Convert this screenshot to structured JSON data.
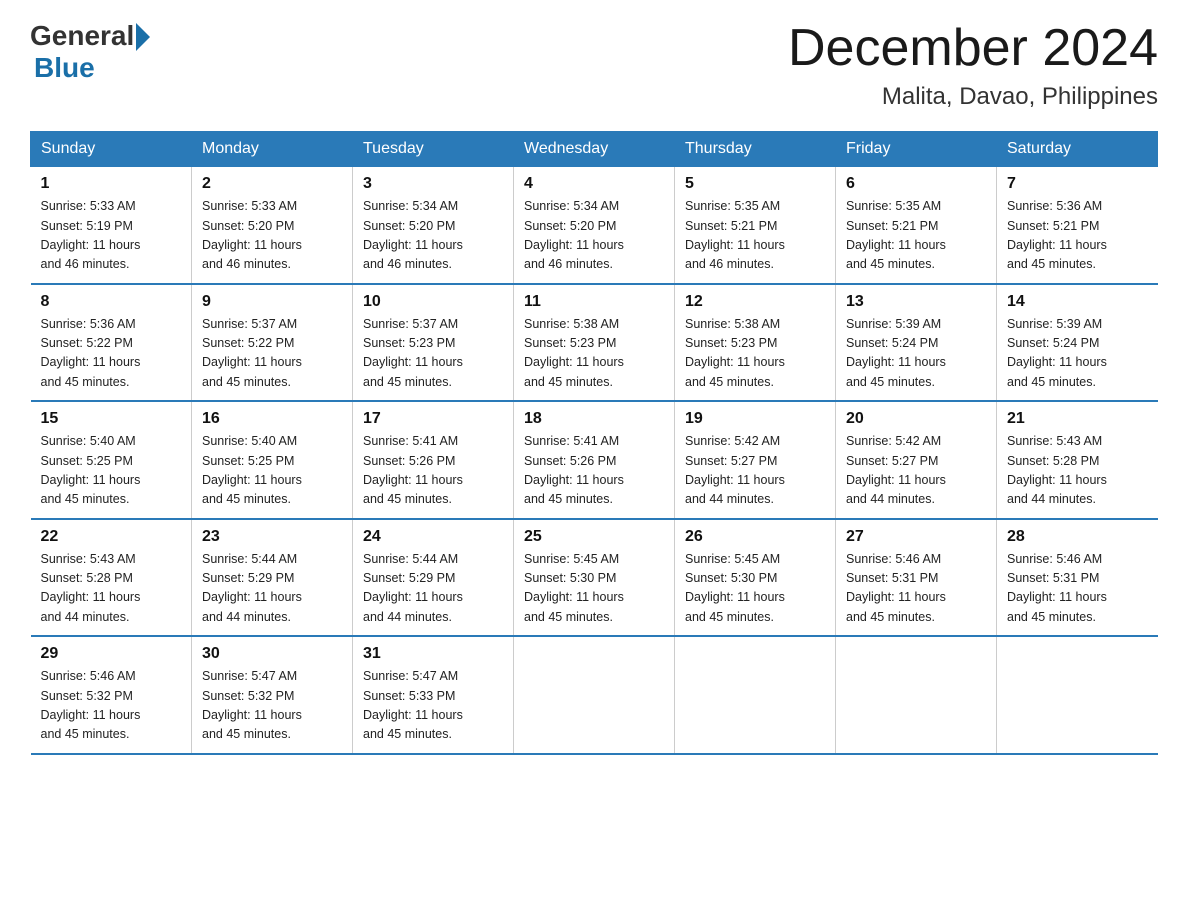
{
  "header": {
    "logo_general": "General",
    "logo_blue": "Blue",
    "month_title": "December 2024",
    "location": "Malita, Davao, Philippines"
  },
  "columns": [
    "Sunday",
    "Monday",
    "Tuesday",
    "Wednesday",
    "Thursday",
    "Friday",
    "Saturday"
  ],
  "weeks": [
    [
      {
        "day": "1",
        "sunrise": "5:33 AM",
        "sunset": "5:19 PM",
        "daylight": "11 hours and 46 minutes."
      },
      {
        "day": "2",
        "sunrise": "5:33 AM",
        "sunset": "5:20 PM",
        "daylight": "11 hours and 46 minutes."
      },
      {
        "day": "3",
        "sunrise": "5:34 AM",
        "sunset": "5:20 PM",
        "daylight": "11 hours and 46 minutes."
      },
      {
        "day": "4",
        "sunrise": "5:34 AM",
        "sunset": "5:20 PM",
        "daylight": "11 hours and 46 minutes."
      },
      {
        "day": "5",
        "sunrise": "5:35 AM",
        "sunset": "5:21 PM",
        "daylight": "11 hours and 46 minutes."
      },
      {
        "day": "6",
        "sunrise": "5:35 AM",
        "sunset": "5:21 PM",
        "daylight": "11 hours and 45 minutes."
      },
      {
        "day": "7",
        "sunrise": "5:36 AM",
        "sunset": "5:21 PM",
        "daylight": "11 hours and 45 minutes."
      }
    ],
    [
      {
        "day": "8",
        "sunrise": "5:36 AM",
        "sunset": "5:22 PM",
        "daylight": "11 hours and 45 minutes."
      },
      {
        "day": "9",
        "sunrise": "5:37 AM",
        "sunset": "5:22 PM",
        "daylight": "11 hours and 45 minutes."
      },
      {
        "day": "10",
        "sunrise": "5:37 AM",
        "sunset": "5:23 PM",
        "daylight": "11 hours and 45 minutes."
      },
      {
        "day": "11",
        "sunrise": "5:38 AM",
        "sunset": "5:23 PM",
        "daylight": "11 hours and 45 minutes."
      },
      {
        "day": "12",
        "sunrise": "5:38 AM",
        "sunset": "5:23 PM",
        "daylight": "11 hours and 45 minutes."
      },
      {
        "day": "13",
        "sunrise": "5:39 AM",
        "sunset": "5:24 PM",
        "daylight": "11 hours and 45 minutes."
      },
      {
        "day": "14",
        "sunrise": "5:39 AM",
        "sunset": "5:24 PM",
        "daylight": "11 hours and 45 minutes."
      }
    ],
    [
      {
        "day": "15",
        "sunrise": "5:40 AM",
        "sunset": "5:25 PM",
        "daylight": "11 hours and 45 minutes."
      },
      {
        "day": "16",
        "sunrise": "5:40 AM",
        "sunset": "5:25 PM",
        "daylight": "11 hours and 45 minutes."
      },
      {
        "day": "17",
        "sunrise": "5:41 AM",
        "sunset": "5:26 PM",
        "daylight": "11 hours and 45 minutes."
      },
      {
        "day": "18",
        "sunrise": "5:41 AM",
        "sunset": "5:26 PM",
        "daylight": "11 hours and 45 minutes."
      },
      {
        "day": "19",
        "sunrise": "5:42 AM",
        "sunset": "5:27 PM",
        "daylight": "11 hours and 44 minutes."
      },
      {
        "day": "20",
        "sunrise": "5:42 AM",
        "sunset": "5:27 PM",
        "daylight": "11 hours and 44 minutes."
      },
      {
        "day": "21",
        "sunrise": "5:43 AM",
        "sunset": "5:28 PM",
        "daylight": "11 hours and 44 minutes."
      }
    ],
    [
      {
        "day": "22",
        "sunrise": "5:43 AM",
        "sunset": "5:28 PM",
        "daylight": "11 hours and 44 minutes."
      },
      {
        "day": "23",
        "sunrise": "5:44 AM",
        "sunset": "5:29 PM",
        "daylight": "11 hours and 44 minutes."
      },
      {
        "day": "24",
        "sunrise": "5:44 AM",
        "sunset": "5:29 PM",
        "daylight": "11 hours and 44 minutes."
      },
      {
        "day": "25",
        "sunrise": "5:45 AM",
        "sunset": "5:30 PM",
        "daylight": "11 hours and 45 minutes."
      },
      {
        "day": "26",
        "sunrise": "5:45 AM",
        "sunset": "5:30 PM",
        "daylight": "11 hours and 45 minutes."
      },
      {
        "day": "27",
        "sunrise": "5:46 AM",
        "sunset": "5:31 PM",
        "daylight": "11 hours and 45 minutes."
      },
      {
        "day": "28",
        "sunrise": "5:46 AM",
        "sunset": "5:31 PM",
        "daylight": "11 hours and 45 minutes."
      }
    ],
    [
      {
        "day": "29",
        "sunrise": "5:46 AM",
        "sunset": "5:32 PM",
        "daylight": "11 hours and 45 minutes."
      },
      {
        "day": "30",
        "sunrise": "5:47 AM",
        "sunset": "5:32 PM",
        "daylight": "11 hours and 45 minutes."
      },
      {
        "day": "31",
        "sunrise": "5:47 AM",
        "sunset": "5:33 PM",
        "daylight": "11 hours and 45 minutes."
      },
      null,
      null,
      null,
      null
    ]
  ],
  "labels": {
    "sunrise": "Sunrise:",
    "sunset": "Sunset:",
    "daylight": "Daylight:"
  }
}
